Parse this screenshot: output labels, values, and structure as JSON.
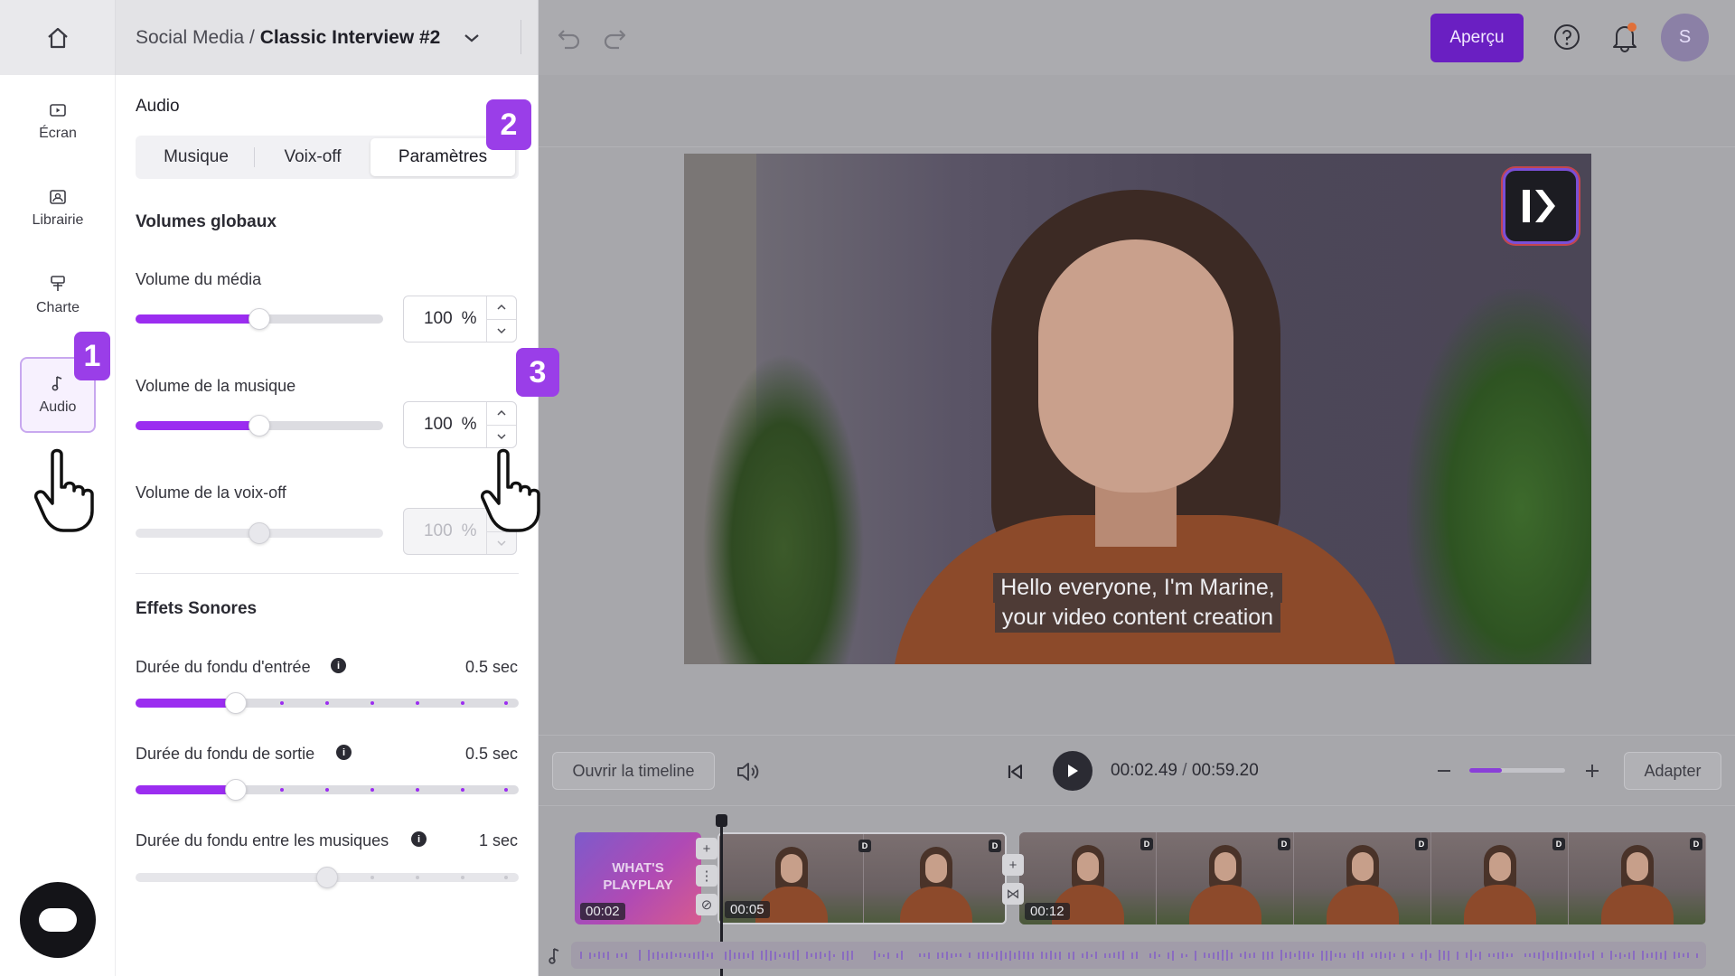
{
  "header": {
    "breadcrumb_parent": "Social Media /",
    "breadcrumb_current": "Classic Interview #2",
    "preview_label": "Aperçu",
    "avatar_initial": "S"
  },
  "sidebar": {
    "items": [
      {
        "label": "Écran",
        "icon": "screen-icon"
      },
      {
        "label": "Librairie",
        "icon": "library-icon"
      },
      {
        "label": "Charte",
        "icon": "brush-icon"
      },
      {
        "label": "Audio",
        "icon": "music-note-icon",
        "active": true
      }
    ]
  },
  "badges": {
    "one": "1",
    "two": "2",
    "three": "3"
  },
  "panel": {
    "title": "Audio",
    "tabs": [
      {
        "label": "Musique",
        "active": false
      },
      {
        "label": "Voix-off",
        "active": false
      },
      {
        "label": "Paramètres",
        "active": true
      }
    ],
    "global_volumes": {
      "title": "Volumes globaux",
      "media": {
        "label": "Volume du média",
        "value": "100",
        "unit": "%",
        "level": 0.5
      },
      "music": {
        "label": "Volume de la musique",
        "value": "100",
        "unit": "%",
        "level": 0.5
      },
      "voiceover": {
        "label": "Volume de la voix-off",
        "value": "100",
        "unit": "%",
        "level": 0.5,
        "disabled": true
      }
    },
    "sound_effects": {
      "title": "Effets Sonores",
      "fade_in": {
        "label": "Durée du fondu d'entrée",
        "value": "0.5 sec",
        "level": 0.26
      },
      "fade_out": {
        "label": "Durée du fondu de sortie",
        "value": "0.5 sec",
        "level": 0.26
      },
      "fade_between": {
        "label": "Durée du fondu entre les musiques",
        "value": "1 sec",
        "level": 0.5
      }
    }
  },
  "preview": {
    "caption_line1": "Hello everyone, I'm Marine,",
    "caption_line2": "your video content creation"
  },
  "player": {
    "open_timeline_label": "Ouvrir la timeline",
    "current_time": "00:02.49",
    "separator": "/",
    "total_time": "00:59.20",
    "fit_label": "Adapter",
    "zoom_level": 0.34
  },
  "timeline": {
    "intro_text_line1": "WHAT'S",
    "intro_text_line2": "PLAYPLAY",
    "clips": [
      {
        "time": "00:02"
      },
      {
        "time": "00:05"
      },
      {
        "time": "00:12"
      }
    ]
  },
  "colors": {
    "accent": "#9b2df0",
    "preview_button": "#6a1fc2",
    "badge": "#9a3ee8"
  }
}
